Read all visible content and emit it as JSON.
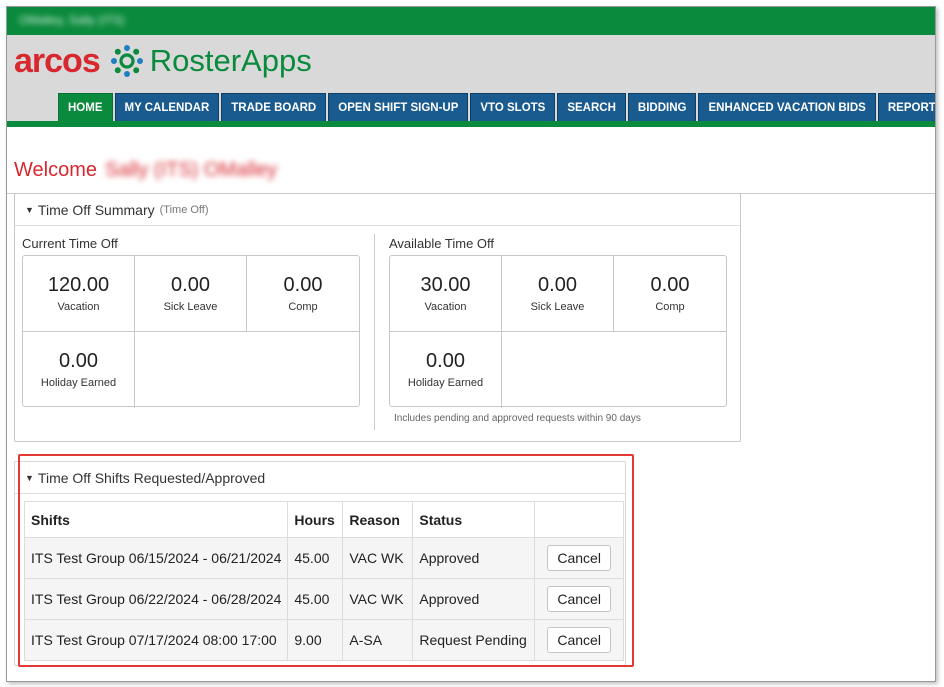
{
  "user": {
    "top_name": "OMalley, Sally (ITS)"
  },
  "brand": {
    "arcos": "arcos",
    "product": "RosterApps"
  },
  "nav": {
    "tabs": [
      {
        "label": "HOME",
        "active": true
      },
      {
        "label": "MY CALENDAR"
      },
      {
        "label": "TRADE BOARD"
      },
      {
        "label": "OPEN SHIFT SIGN-UP"
      },
      {
        "label": "VTO SLOTS"
      },
      {
        "label": "SEARCH"
      },
      {
        "label": "BIDDING"
      },
      {
        "label": "ENHANCED VACATION BIDS"
      },
      {
        "label": "REPORTS"
      }
    ]
  },
  "welcome": {
    "label": "Welcome",
    "name": "Sally (ITS) OMalley"
  },
  "summary": {
    "title": "Time Off Summary",
    "subtitle": "(Time Off)",
    "current": {
      "title": "Current Time Off",
      "items": [
        {
          "value": "120.00",
          "label": "Vacation"
        },
        {
          "value": "0.00",
          "label": "Sick Leave"
        },
        {
          "value": "0.00",
          "label": "Comp"
        },
        {
          "value": "0.00",
          "label": "Holiday Earned"
        }
      ]
    },
    "available": {
      "title": "Available Time Off",
      "items": [
        {
          "value": "30.00",
          "label": "Vacation"
        },
        {
          "value": "0.00",
          "label": "Sick Leave"
        },
        {
          "value": "0.00",
          "label": "Comp"
        },
        {
          "value": "0.00",
          "label": "Holiday Earned"
        }
      ],
      "note": "Includes pending and approved requests within 90 days"
    }
  },
  "shifts": {
    "title": "Time Off Shifts Requested/Approved",
    "columns": [
      "Shifts",
      "Hours",
      "Reason",
      "Status"
    ],
    "rows": [
      {
        "shift": "ITS Test Group 06/15/2024 - 06/21/2024",
        "hours": "45.00",
        "reason": "VAC WK",
        "status": "Approved",
        "action": "Cancel"
      },
      {
        "shift": "ITS Test Group 06/22/2024 - 06/28/2024",
        "hours": "45.00",
        "reason": "VAC WK",
        "status": "Approved",
        "action": "Cancel"
      },
      {
        "shift": "ITS Test Group 07/17/2024 08:00 17:00",
        "hours": "9.00",
        "reason": "A-SA",
        "status": "Request Pending",
        "action": "Cancel"
      }
    ]
  },
  "colors": {
    "green": "#0a8a3c",
    "navy": "#1a5b8f",
    "red": "#d7282f",
    "highlight": "#e53935"
  }
}
